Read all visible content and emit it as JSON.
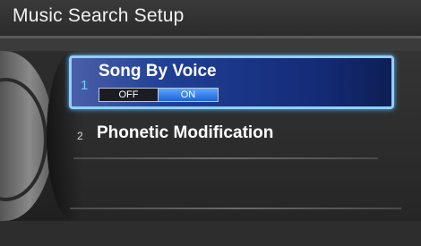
{
  "header": {
    "title": "Music Search Setup"
  },
  "menu": {
    "items": [
      {
        "number": "1",
        "label": "Song By Voice",
        "selected": true,
        "options": [
          {
            "label": "OFF",
            "active": false
          },
          {
            "label": "ON",
            "active": true
          }
        ]
      },
      {
        "number": "2",
        "label": "Phonetic Modification",
        "selected": false
      }
    ]
  },
  "colors": {
    "highlight_border": "#8fd0ff",
    "highlight_fill": "#1f3f95",
    "toggle_on": "#3b86f0"
  }
}
